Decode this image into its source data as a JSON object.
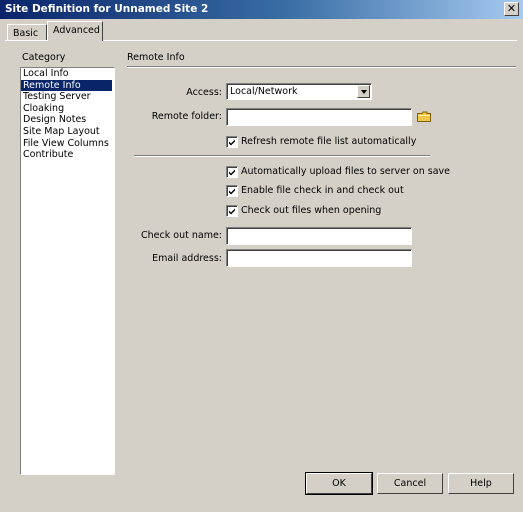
{
  "window": {
    "title": "Site Definition for Unnamed Site 2",
    "close_glyph": "✕"
  },
  "tabs": [
    {
      "label": "Basic",
      "active": false
    },
    {
      "label": "Advanced",
      "active": true
    }
  ],
  "category": {
    "heading": "Category",
    "items": [
      {
        "label": "Local Info",
        "selected": false
      },
      {
        "label": "Remote Info",
        "selected": true
      },
      {
        "label": "Testing Server",
        "selected": false
      },
      {
        "label": "Cloaking",
        "selected": false
      },
      {
        "label": "Design Notes",
        "selected": false
      },
      {
        "label": "Site Map Layout",
        "selected": false
      },
      {
        "label": "File View Columns",
        "selected": false
      },
      {
        "label": "Contribute",
        "selected": false
      }
    ]
  },
  "section": {
    "title": "Remote Info",
    "access_label": "Access:",
    "access_value": "Local/Network",
    "remote_folder_label": "Remote folder:",
    "remote_folder_value": "",
    "folder_icon": "folder-icon",
    "checkout_name_label": "Check out name:",
    "checkout_name_value": "",
    "email_label": "Email address:",
    "email_value": ""
  },
  "checkboxes": {
    "refresh": {
      "label": "Refresh remote file list automatically",
      "checked": true
    },
    "auto_upload": {
      "label": "Automatically upload files to server on save",
      "checked": true
    },
    "check_in_out": {
      "label": "Enable file check in and check out",
      "checked": true
    },
    "check_out_opening": {
      "label": "Check out files when opening",
      "checked": true
    }
  },
  "buttons": {
    "ok": "OK",
    "cancel": "Cancel",
    "help": "Help"
  },
  "colors": {
    "selection": "#0a246a",
    "face": "#d4d0c8"
  }
}
